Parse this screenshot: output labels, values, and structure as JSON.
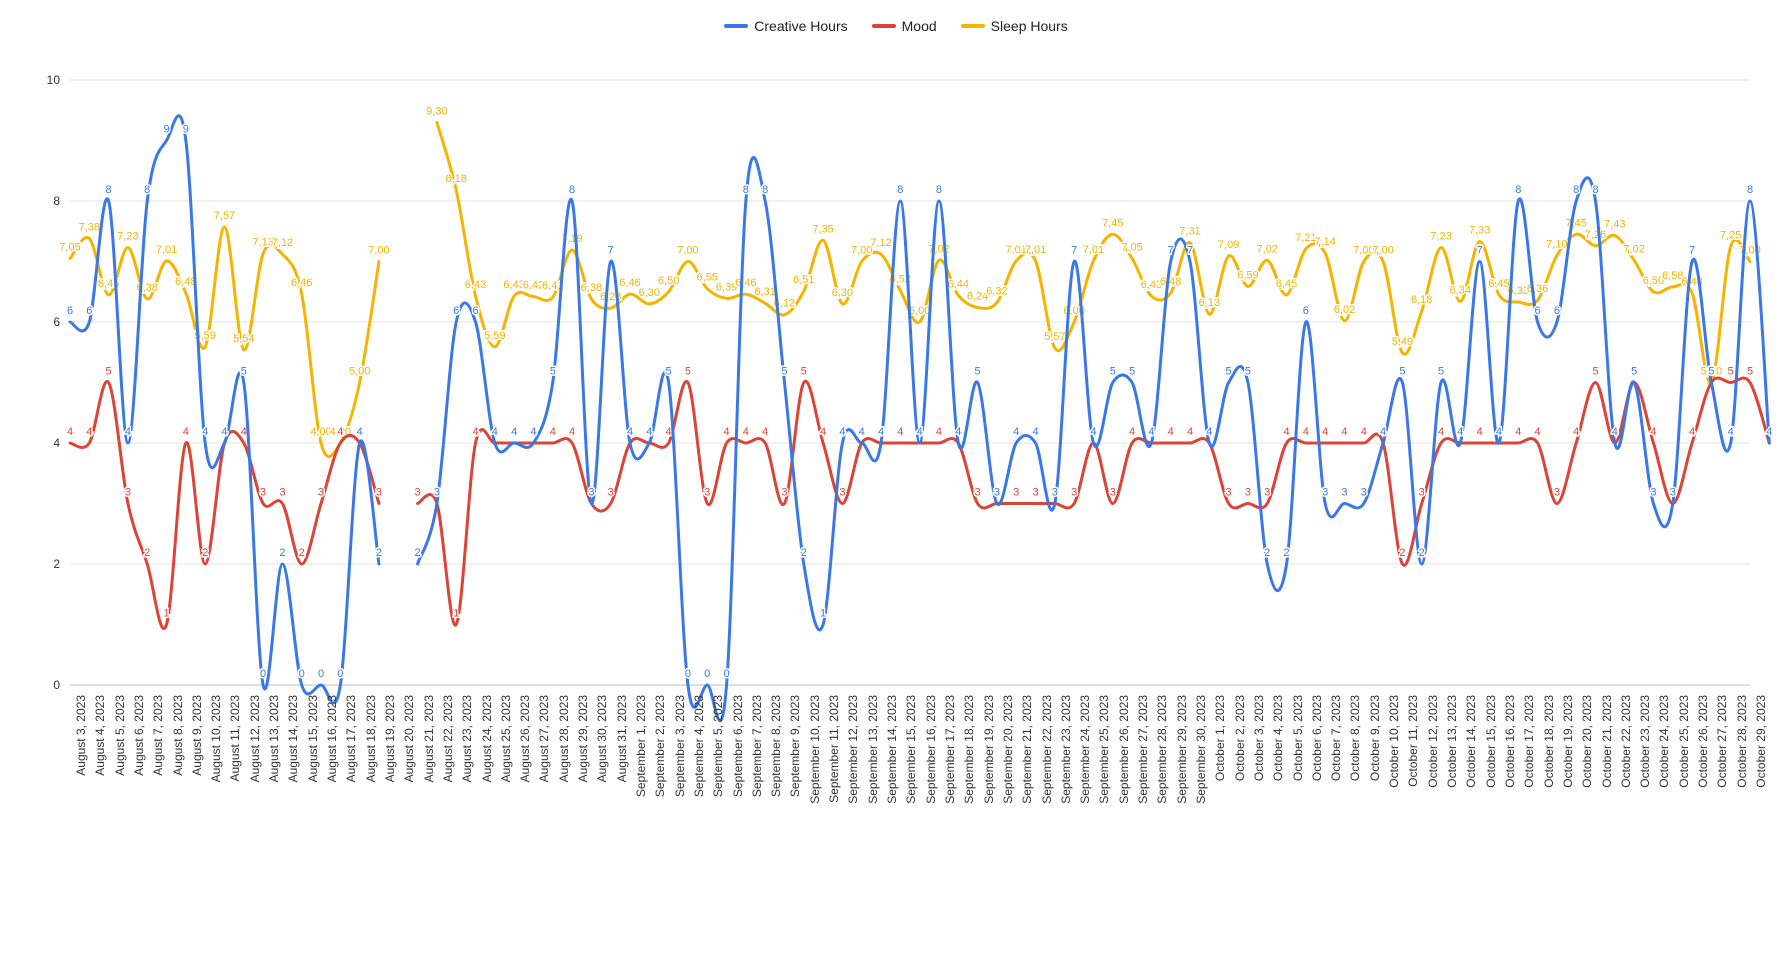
{
  "chart_data": {
    "type": "line",
    "title": "",
    "xlabel": "",
    "ylabel": "",
    "ylim": [
      0,
      10
    ],
    "yticks": [
      0,
      2,
      4,
      6,
      8,
      10
    ],
    "categories": [
      "August 3, 2023",
      "August 4, 2023",
      "August 5, 2023",
      "August 6, 2023",
      "August 7, 2023",
      "August 8, 2023",
      "August 9, 2023",
      "August 10, 2023",
      "August 11, 2023",
      "August 12, 2023",
      "August 13, 2023",
      "August 14, 2023",
      "August 15, 2023",
      "August 16, 2023",
      "August 17, 2023",
      "August 18, 2023",
      "August 19, 2023",
      "August 20, 2023",
      "August 21, 2023",
      "August 22, 2023",
      "August 23, 2023",
      "August 24, 2023",
      "August 25, 2023",
      "August 26, 2023",
      "August 27, 2023",
      "August 28, 2023",
      "August 29, 2023",
      "August 30, 2023",
      "August 31, 2023",
      "September 1, 2023",
      "September 2, 2023",
      "September 3, 2023",
      "September 4, 2023",
      "September 5, 2023",
      "September 6, 2023",
      "September 7, 2023",
      "September 8, 2023",
      "September 9, 2023",
      "September 10, 2023",
      "September 11, 2023",
      "September 12, 2023",
      "September 13, 2023",
      "September 14, 2023",
      "September 15, 2023",
      "September 16, 2023",
      "September 17, 2023",
      "September 18, 2023",
      "September 19, 2023",
      "September 20, 2023",
      "September 21, 2023",
      "September 22, 2023",
      "September 23, 2023",
      "September 24, 2023",
      "September 25, 2023",
      "September 26, 2023",
      "September 27, 2023",
      "September 28, 2023",
      "September 29, 2023",
      "September 30, 2023",
      "October 1, 2023",
      "October 2, 2023",
      "October 3, 2023",
      "October 4, 2023",
      "October 5, 2023",
      "October 6, 2023",
      "October 7, 2023",
      "October 8, 2023",
      "October 9, 2023",
      "October 10, 2023",
      "October 11, 2023",
      "October 12, 2023",
      "October 13, 2023",
      "October 14, 2023",
      "October 15, 2023",
      "October 16, 2023",
      "October 17, 2023",
      "October 18, 2023",
      "October 19, 2023",
      "October 20, 2023",
      "October 21, 2023",
      "October 22, 2023",
      "October 23, 2023",
      "October 24, 2023",
      "October 25, 2023",
      "October 26, 2023",
      "October 27, 2023",
      "October 28, 2023",
      "October 29, 2023"
    ],
    "series": [
      {
        "name": "Creative Hours",
        "color": "#3b78e7",
        "values": [
          6,
          6,
          8,
          4,
          8,
          9,
          9,
          4,
          4,
          5,
          0,
          2,
          0,
          0,
          0,
          4,
          2,
          null,
          2,
          3,
          6,
          6,
          4,
          4,
          4,
          5,
          8,
          3,
          7,
          4,
          4,
          5,
          0,
          0,
          0,
          8,
          8,
          5,
          2,
          1,
          4,
          4,
          4,
          8,
          4,
          8,
          4,
          5,
          3,
          4,
          4,
          3,
          7,
          4,
          5,
          5,
          4,
          7,
          7,
          4,
          5,
          5,
          2,
          2,
          6,
          3,
          3,
          3,
          4,
          5,
          2,
          5,
          4,
          7,
          4,
          8,
          6,
          6,
          8,
          8,
          4,
          5,
          3,
          3,
          7,
          5,
          4,
          8,
          4
        ]
      },
      {
        "name": "Mood",
        "color": "#db4437",
        "values": [
          4,
          4,
          5,
          3,
          2,
          1,
          4,
          2,
          4,
          4,
          3,
          3,
          2,
          3,
          4,
          4,
          3,
          null,
          3,
          3,
          1,
          4,
          4,
          4,
          4,
          4,
          4,
          3,
          3,
          4,
          4,
          4,
          5,
          3,
          4,
          4,
          4,
          3,
          5,
          4,
          3,
          4,
          4,
          4,
          4,
          4,
          4,
          3,
          3,
          3,
          3,
          3,
          3,
          4,
          3,
          4,
          4,
          4,
          4,
          4,
          3,
          3,
          3,
          4,
          4,
          4,
          4,
          4,
          4,
          2,
          3,
          4,
          4,
          4,
          4,
          4,
          4,
          3,
          4,
          5,
          4,
          5,
          4,
          3,
          4,
          5,
          5,
          5,
          4
        ]
      },
      {
        "name": "Sleep Hours",
        "color": "#f4b400",
        "values": [
          7.05,
          7.38,
          6.45,
          7.23,
          6.38,
          7.01,
          6.48,
          5.59,
          7.57,
          5.54,
          7.13,
          7.12,
          6.46,
          4.0,
          4.0,
          5.0,
          7.0,
          null,
          null,
          9.3,
          8.18,
          6.43,
          5.59,
          6.43,
          6.42,
          6.41,
          7.19,
          6.38,
          6.23,
          6.46,
          6.3,
          6.5,
          7.0,
          6.55,
          6.39,
          6.46,
          6.31,
          6.12,
          6.51,
          7.35,
          6.3,
          7.0,
          7.12,
          6.52,
          6.0,
          7.02,
          6.44,
          6.24,
          6.32,
          7.01,
          7.01,
          5.57,
          6.0,
          7.01,
          7.45,
          7.05,
          6.43,
          6.48,
          7.31,
          6.13,
          7.09,
          6.59,
          7.02,
          6.45,
          7.21,
          7.14,
          6.02,
          7.0,
          7.0,
          5.49,
          6.18,
          7.23,
          6.34,
          7.33,
          6.45,
          6.33,
          6.36,
          7.1,
          7.45,
          7.26,
          7.43,
          7.02,
          6.5,
          6.58,
          6.48,
          5.0,
          7.25,
          7.0
        ]
      }
    ],
    "legend_position": "top"
  },
  "legend": {
    "items": [
      {
        "label": "Creative Hours",
        "color": "#3b78e7"
      },
      {
        "label": "Mood",
        "color": "#db4437"
      },
      {
        "label": "Sleep Hours",
        "color": "#f4b400"
      }
    ]
  }
}
